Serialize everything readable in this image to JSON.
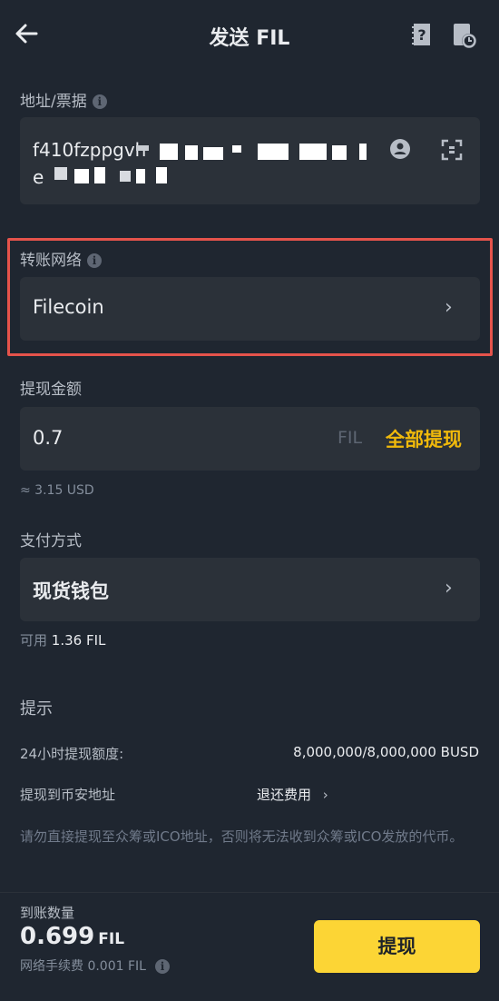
{
  "header": {
    "title": "发送 FIL"
  },
  "address": {
    "label": "地址/票据",
    "value_line1": "f410fzppgvh",
    "value_line2": "e"
  },
  "network": {
    "label": "转账网络",
    "value": "Filecoin"
  },
  "amount": {
    "label": "提现金额",
    "value": "0.7",
    "unit": "FIL",
    "all_label": "全部提现",
    "approx": "≈ 3.15 USD"
  },
  "payment": {
    "label": "支付方式",
    "value": "现货钱包",
    "available_prefix": "可用",
    "available_value": "1.36 FIL"
  },
  "tips": {
    "title": "提示",
    "quota_label": "24小时提现额度:",
    "quota_value": "8,000,000/8,000,000 BUSD",
    "binance_label": "提现到币安地址",
    "binance_value": "退还费用",
    "warning": "请勿直接提现至众筹或ICO地址，否则将无法收到众筹或ICO发放的代币。"
  },
  "footer": {
    "receive_label": "到账数量",
    "receive_value": "0.699",
    "receive_unit": "FIL",
    "fee_text": "网络手续费 0.001 FIL",
    "withdraw_button": "提现"
  },
  "colors": {
    "background": "#1f2630",
    "card": "#2b3139",
    "accent": "#f0b90b",
    "button": "#fcd535",
    "highlight": "#e5534b"
  }
}
